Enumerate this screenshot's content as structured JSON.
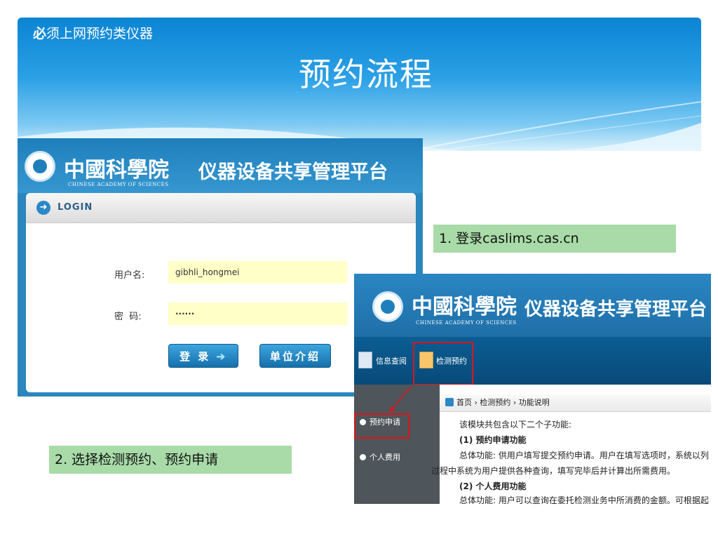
{
  "slide": {
    "subtitle_bold": "必",
    "subtitle_rest": "须上网预约类仪器",
    "title": "预约流程"
  },
  "login_screen": {
    "logo_cn": "中國科學院",
    "logo_en": "CHINESE ACADEMY OF SCIENCES",
    "platform_name": "仪器设备共享管理平台",
    "panel_title": "LOGIN",
    "username_label": "用户名:",
    "username_value": "gibhli_hongmei",
    "password_label": "密  码:",
    "password_value": "······",
    "login_button": "登 录",
    "unit_button": "单位介绍"
  },
  "steps": {
    "step1": "1. 登录caslims.cas.cn",
    "step2": "2. 选择检测预约、预约申请"
  },
  "booking_screen": {
    "logo_cn": "中國科學院",
    "logo_en": "CHINESE ACADEMY OF SCIENCES",
    "platform_name": "仪器设备共享管理平台",
    "nav": {
      "info_query": "信息查阅",
      "test_booking": "检测预约"
    },
    "sidebar": [
      "预约申请",
      "个人费用"
    ],
    "breadcrumb": "首页 › 检测预约 › 功能说明",
    "content": {
      "intro": "该模块共包含以下二个子功能:",
      "sec1_title": "(1) 预约申请功能",
      "sec1_text": "总体功能: 供用户填写提交预约申请。用户在填写选项时，系统以列",
      "sec1_text2": "过程中系统为用户提供各种查询，填写完毕后并计算出所需费用。",
      "sec2_title": "(2) 个人费用功能",
      "sec2_text": "总体功能: 用户可以查询在委托检测业务中所消费的金额。可根据起"
    }
  },
  "colors": {
    "header_blue": "#1b8fd9",
    "step_green": "#a8dba8",
    "highlight_red": "#e0141a"
  }
}
